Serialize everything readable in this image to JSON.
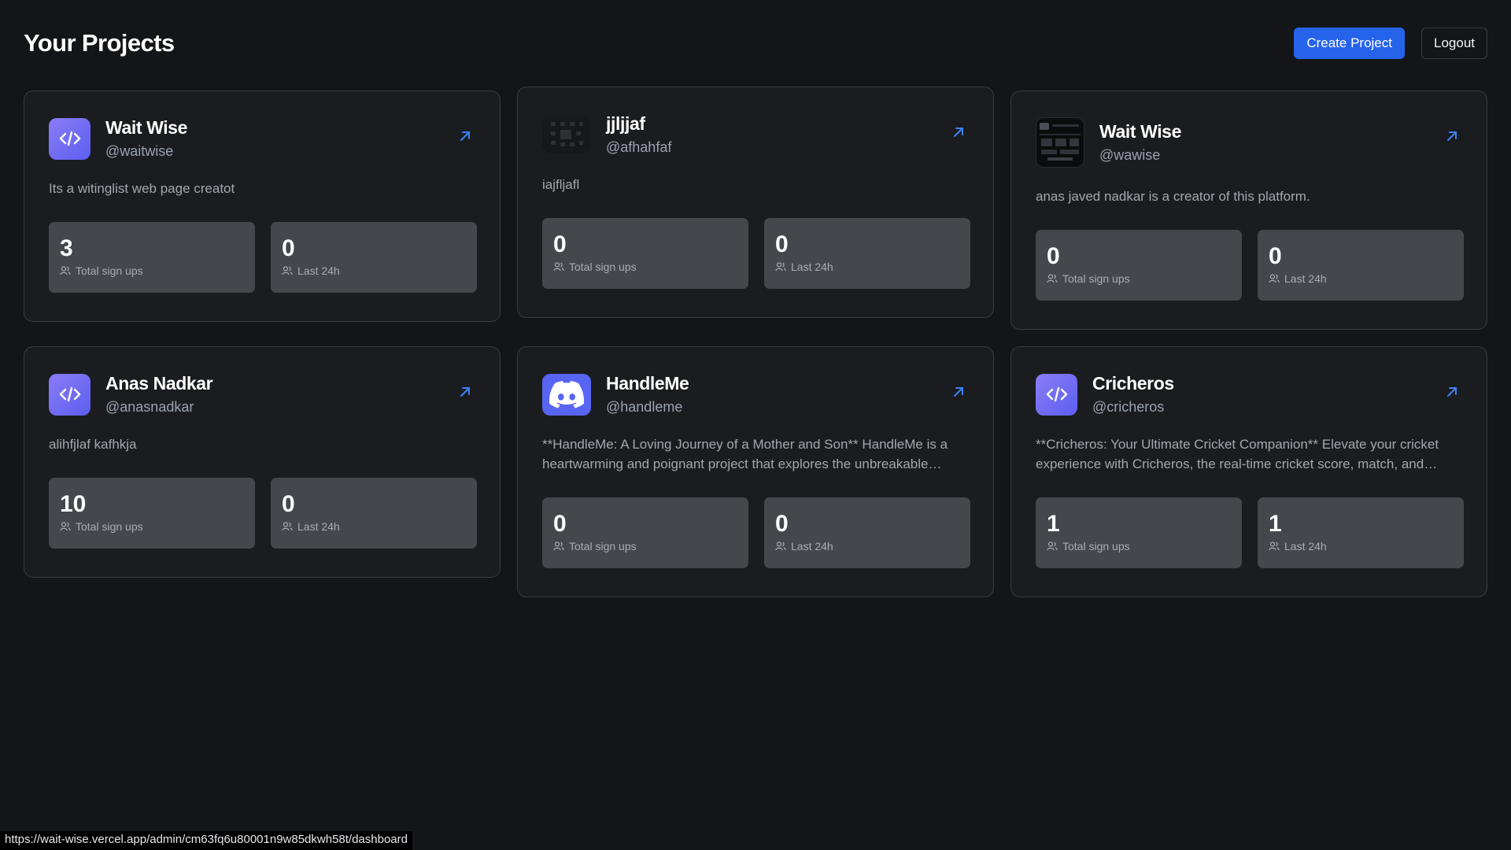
{
  "header": {
    "title": "Your Projects",
    "create_label": "Create Project",
    "logout_label": "Logout"
  },
  "projects": [
    {
      "name": "Wait Wise",
      "handle": "@waitwise",
      "logo": "code-icon",
      "description": "Its a witinglist web page creatot",
      "total_signups": "3",
      "total_label": "Total sign ups",
      "last24": "0",
      "last24_label": "Last 24h"
    },
    {
      "name": "jjljjaf",
      "handle": "@afhahfaf",
      "logo": "image-thumbnail",
      "description": "iajfljafl",
      "total_signups": "0",
      "total_label": "Total sign ups",
      "last24": "0",
      "last24_label": "Last 24h"
    },
    {
      "name": "Wait Wise",
      "handle": "@wawise",
      "logo": "image-thumbnail",
      "description": "anas javed nadkar is a creator of this platform.",
      "total_signups": "0",
      "total_label": "Total sign ups",
      "last24": "0",
      "last24_label": "Last 24h"
    },
    {
      "name": "Anas Nadkar",
      "handle": "@anasnadkar",
      "logo": "code-icon",
      "description": "alihfjlaf kafhkja",
      "total_signups": "10",
      "total_label": "Total sign ups",
      "last24": "0",
      "last24_label": "Last 24h"
    },
    {
      "name": "HandleMe",
      "handle": "@handleme",
      "logo": "discord-icon",
      "description": "**HandleMe: A Loving Journey of a Mother and Son** HandleMe is a heartwarming and poignant project that explores the unbreakable bond...",
      "total_signups": "0",
      "total_label": "Total sign ups",
      "last24": "0",
      "last24_label": "Last 24h"
    },
    {
      "name": "Cricheros",
      "handle": "@cricheros",
      "logo": "code-icon",
      "description": "**Cricheros: Your Ultimate Cricket Companion** Elevate your cricket experience with Cricheros, the real-time cricket score, match, and fantas...",
      "total_signups": "1",
      "total_label": "Total sign ups",
      "last24": "1",
      "last24_label": "Last 24h"
    }
  ],
  "status_bar": {
    "url": "https://wait-wise.vercel.app/admin/cm63fq6u80001n9w85dkwh58t/dashboard"
  },
  "colors": {
    "background": "#141518",
    "card": "#1b1c20",
    "stat_box": "#45474d",
    "accent": "#2563eb",
    "logo_gradient": "#6d6af5",
    "discord": "#5865f2"
  }
}
